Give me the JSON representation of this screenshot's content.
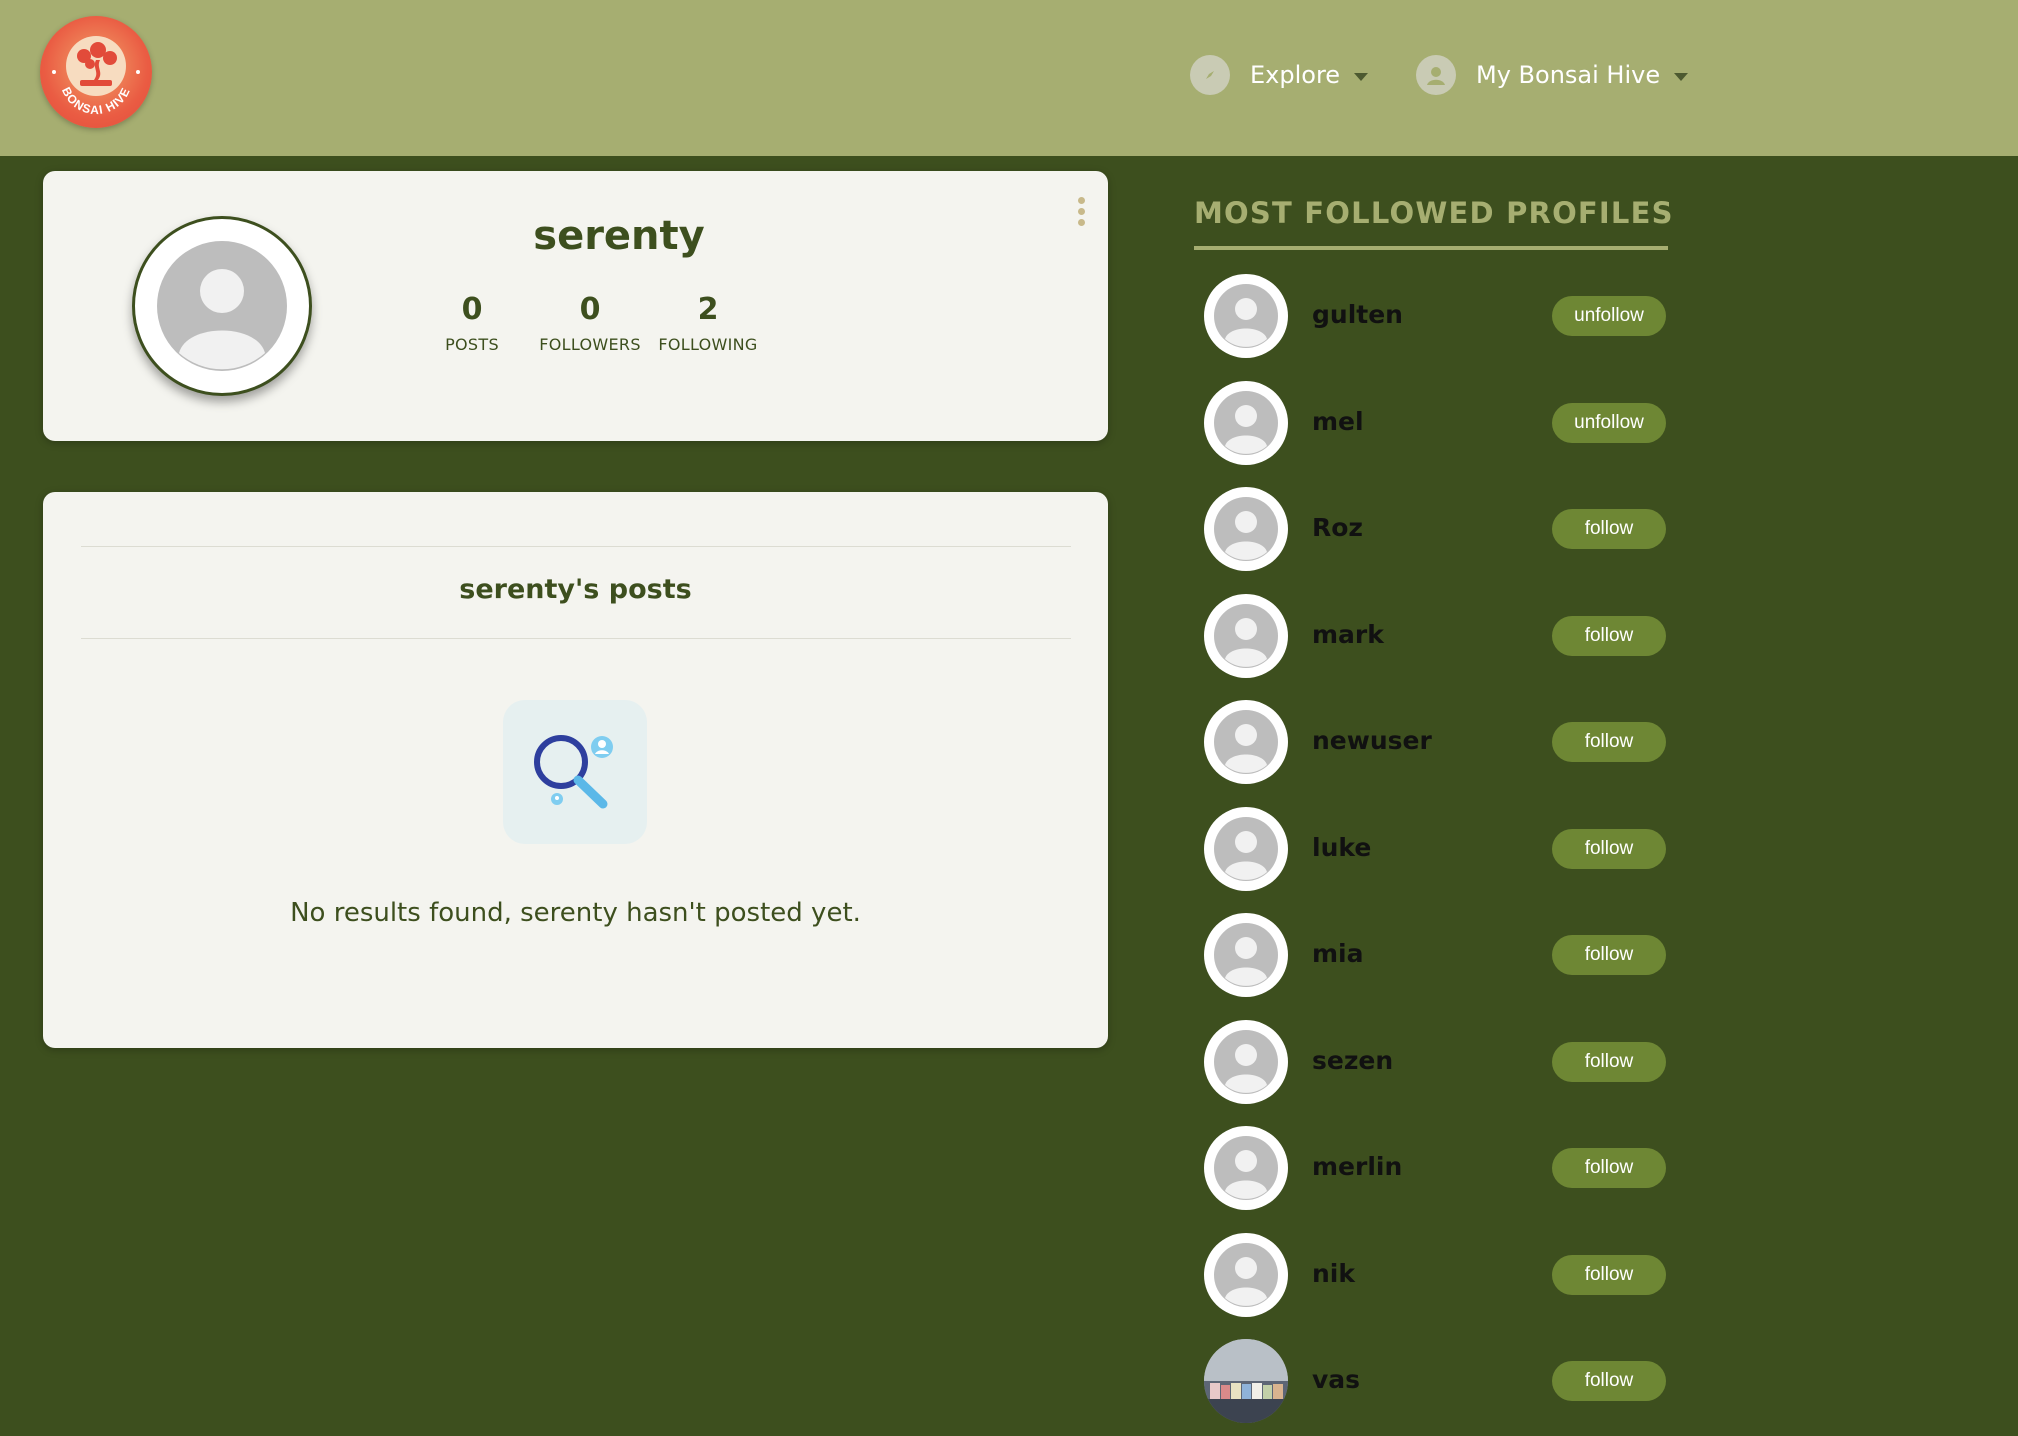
{
  "header": {
    "logo_text": "BONSAI HIVE",
    "nav": {
      "explore_label": "Explore",
      "account_label": "My Bonsai Hive"
    }
  },
  "profile": {
    "username": "serenty",
    "stats": [
      {
        "value": "0",
        "label": "POSTS"
      },
      {
        "value": "0",
        "label": "FOLLOWERS"
      },
      {
        "value": "2",
        "label": "FOLLOWING"
      }
    ]
  },
  "posts": {
    "title": "serenty's posts",
    "empty_message": "No results found, serenty hasn't posted yet."
  },
  "sidebar": {
    "heading": "MOST FOLLOWED PROFILES",
    "profiles": [
      {
        "name": "gulten",
        "action": "unfollow"
      },
      {
        "name": "mel",
        "action": "unfollow"
      },
      {
        "name": "Roz",
        "action": "follow"
      },
      {
        "name": "mark",
        "action": "follow"
      },
      {
        "name": "newuser",
        "action": "follow"
      },
      {
        "name": "luke",
        "action": "follow"
      },
      {
        "name": "mia",
        "action": "follow"
      },
      {
        "name": "sezen",
        "action": "follow"
      },
      {
        "name": "merlin",
        "action": "follow"
      },
      {
        "name": "nik",
        "action": "follow"
      },
      {
        "name": "vas",
        "action": "follow"
      }
    ]
  },
  "colors": {
    "header_bg": "#a6ae71",
    "page_bg": "#3d4f1e",
    "card_bg": "#f4f4ef",
    "button_bg": "#6e8734",
    "logo_red": "#e24b3a"
  },
  "icons": {
    "explore": "compass-icon",
    "account": "user-circle-icon",
    "menu": "kebab-menu-icon",
    "empty": "search-magnifier-icon"
  }
}
